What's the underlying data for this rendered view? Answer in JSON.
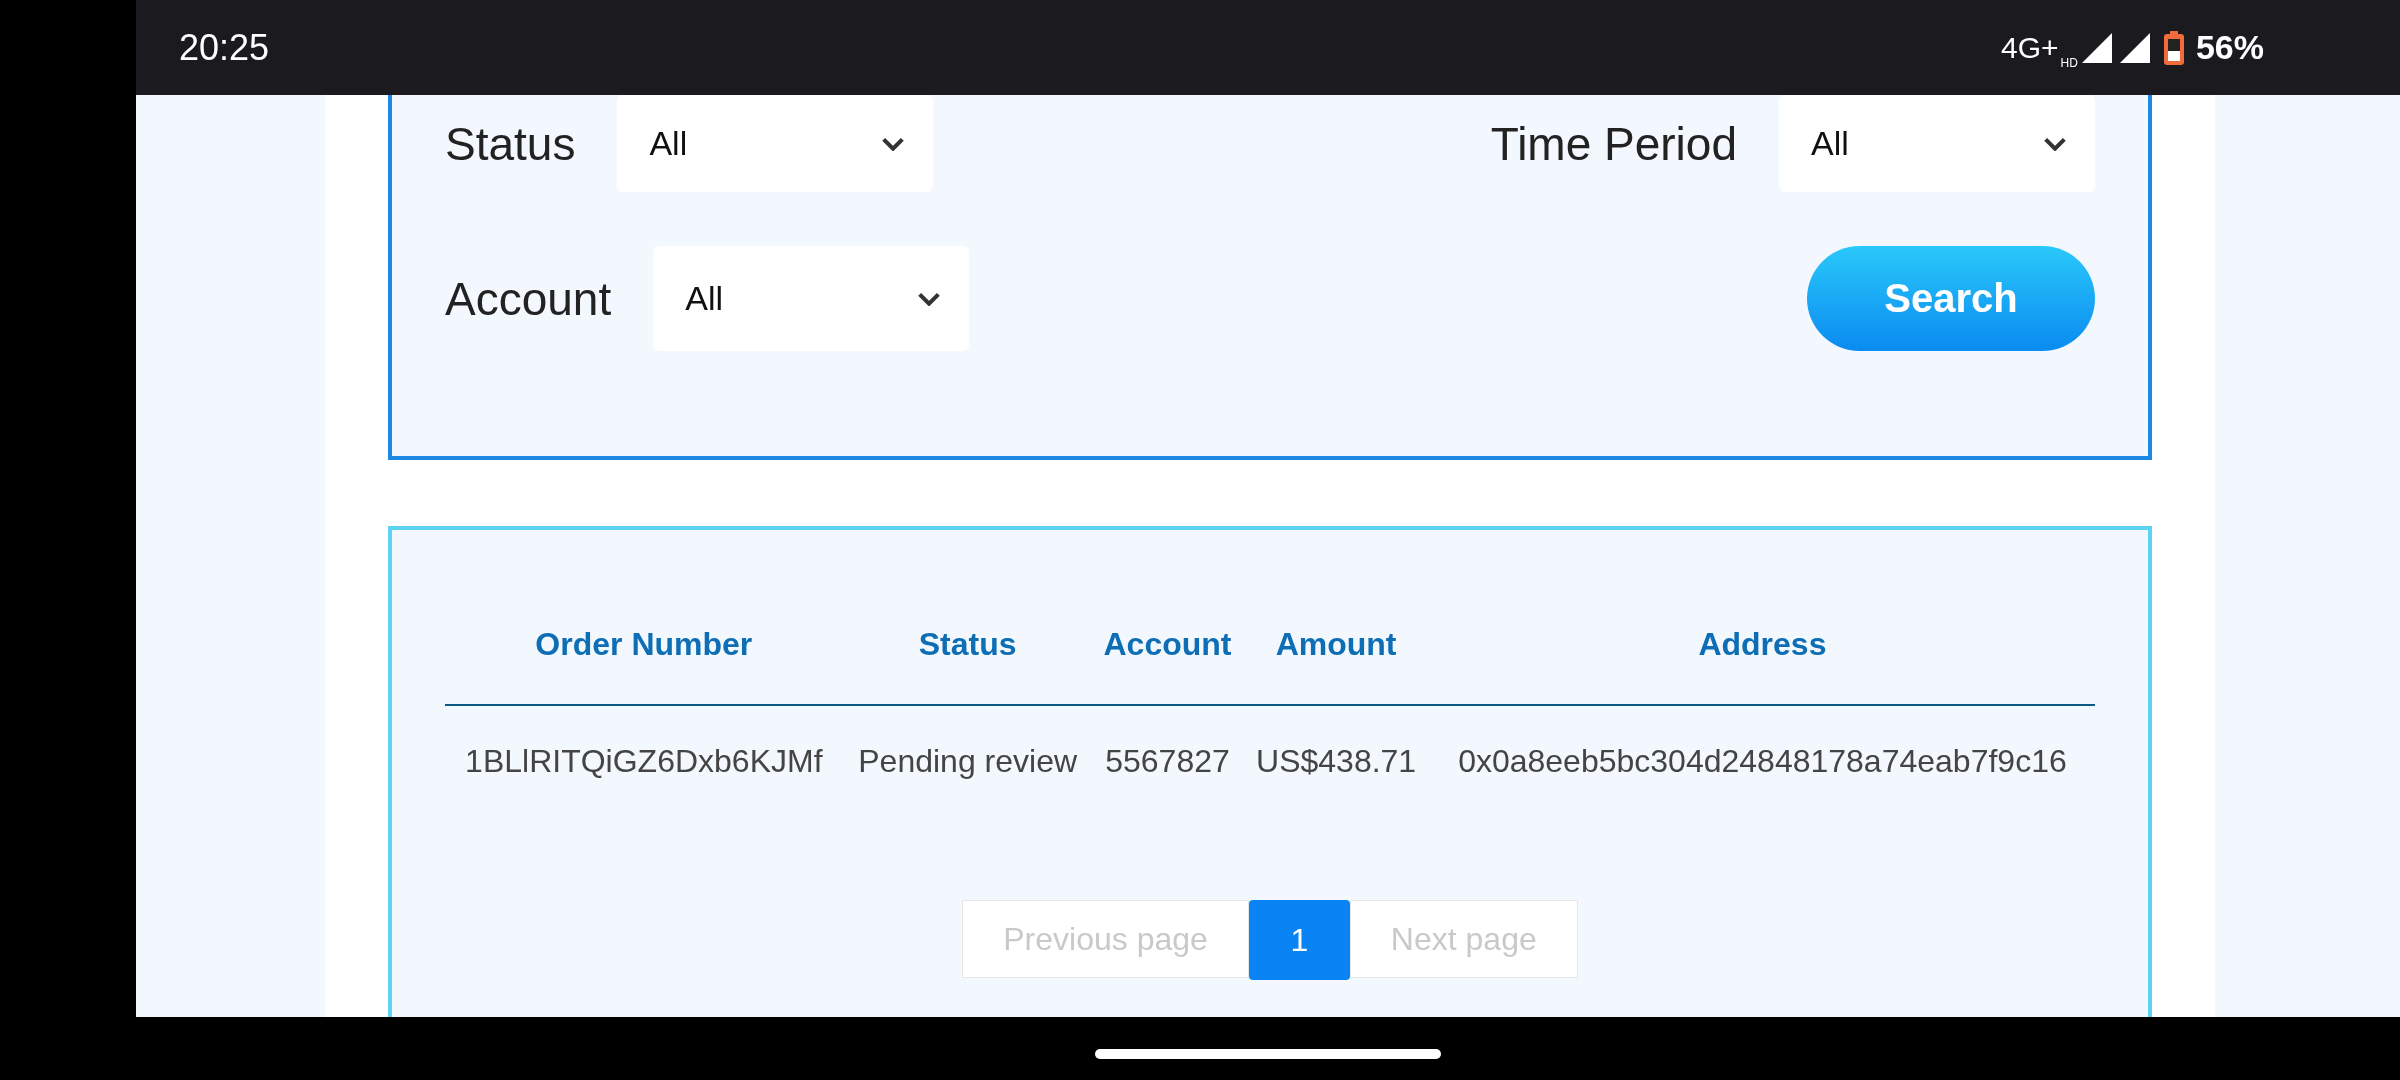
{
  "status_bar": {
    "time": "20:25",
    "network": "4G+",
    "network_badge": "HD",
    "battery": "56%"
  },
  "filters": {
    "status": {
      "label": "Status",
      "value": "All"
    },
    "time_period": {
      "label": "Time Period",
      "value": "All"
    },
    "account": {
      "label": "Account",
      "value": "All"
    },
    "search_button": "Search"
  },
  "table": {
    "columns": [
      "Order Number",
      "Status",
      "Account",
      "Amount",
      "Address"
    ],
    "rows": [
      [
        "1BLlRITQiGZ6Dxb6KJMf",
        "Pending review",
        "5567827",
        "US$438.71",
        "0x0a8eeb5bc304d24848178a74eab7f9c16"
      ]
    ]
  },
  "pagination": {
    "previous": "Previous page",
    "next": "Next page",
    "pages": [
      {
        "label": "1",
        "selected": true
      }
    ]
  }
}
